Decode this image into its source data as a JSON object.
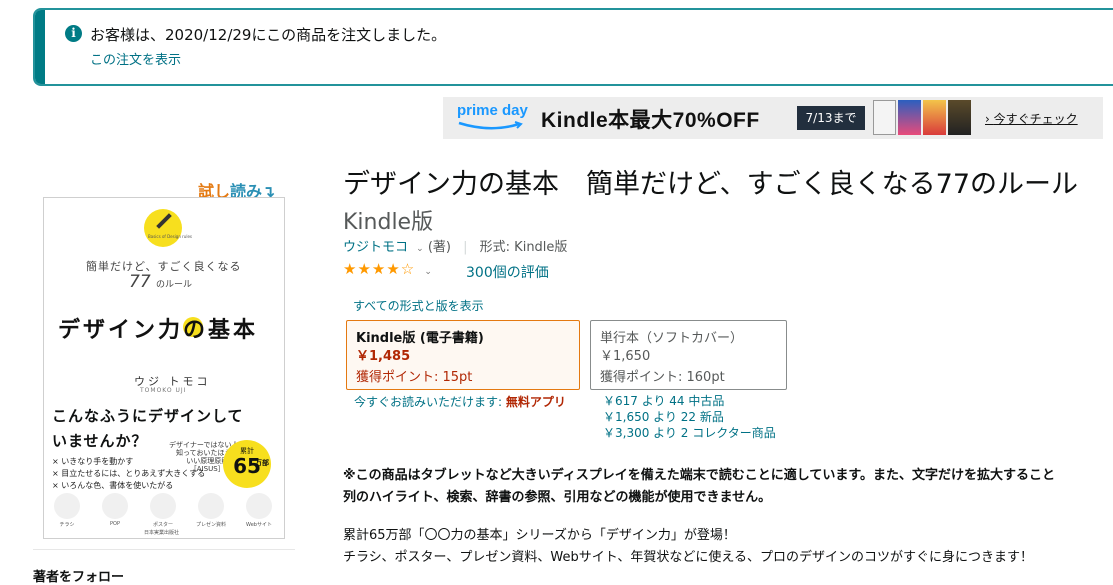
{
  "order_notice": {
    "message": "お客様は、2020/12/29にこの商品を注文しました。",
    "link": "この注文を表示"
  },
  "banner": {
    "logo_text": "prime day",
    "headline": "Kindle本最大70%OFF",
    "date_badge": "7/13まで",
    "cta": "今すぐチェック"
  },
  "try_read": {
    "part1": "試し",
    "part2": "読み"
  },
  "book_cover": {
    "badge_small": "Basics of Design rules",
    "subtitle": "簡単だけど、すごく良くなる",
    "number": "77",
    "number_suffix": "のルール",
    "title": "デザイン力の基本",
    "author_jp": "ウジ トモコ",
    "author_en": "TOMOKO UJI",
    "question_line1": "こんなふうにデザインして",
    "question_line2": "いませんか？",
    "note": "デザイナーではない人も\n知っておいたほうが\nいい原理原則\n［AISUS］",
    "list": [
      "いきなり手を動かす",
      "目立たせるには、とりあえず大きくする",
      "いろんな色、書体を使いたがる"
    ],
    "badge_top": "累計",
    "badge_number": "65",
    "badge_suffix": "万部",
    "icons": [
      "チラシ",
      "POP",
      "ポスター",
      "プレゼン資料",
      "Webサイト"
    ],
    "publisher": "日本実業出版社"
  },
  "follow_label": "著者をフォロー",
  "product": {
    "title": "デザイン力の基本　簡単だけど、すごく良くなる77のルール",
    "format": "Kindle版",
    "author": "ウジトモコ",
    "author_role": "(著)",
    "format_label": "形式: Kindle版",
    "rating_stars": 4,
    "rating_count": "300個の評価",
    "all_formats_link": "すべての形式と版を表示"
  },
  "formats": [
    {
      "name": "Kindle版 (電子書籍)",
      "price": "￥1,485",
      "points": "獲得ポイント: 15pt"
    },
    {
      "name": "単行本（ソフトカバー）",
      "price": "￥1,650",
      "points": "獲得ポイント: 160pt"
    }
  ],
  "read_now": {
    "text": "今すぐお読みいただけます: ",
    "bold": "無料アプリ"
  },
  "offers": [
    "￥617 より 44 中古品",
    "￥1,650 より 22 新品",
    "￥3,300 より 2 コレクター商品"
  ],
  "description": {
    "line1": "※この商品はタブレットなど大きいディスプレイを備えた端末で読むことに適しています。また、文字だけを拡大すること",
    "line2": "列のハイライト、検索、辞書の参照、引用などの機能が使用できません。",
    "line3": "累計65万部「〇〇力の基本」シリーズから「デザイン力」が登場！",
    "line4": "チラシ、ポスター、プレゼン資料、Webサイト、年賀状などに使える、プロのデザインのコツがすぐに身につきます！"
  },
  "colors": {
    "notice_accent": "#007b85",
    "link": "#007185",
    "price_red": "#b12704",
    "star": "#ff9900",
    "selected_border": "#e47911",
    "cover_yellow": "#f7df1e"
  }
}
